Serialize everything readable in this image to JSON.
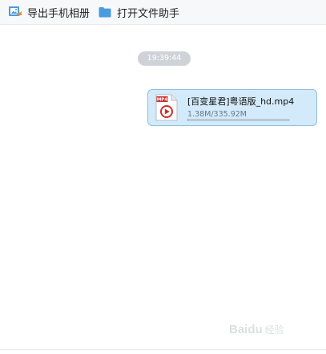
{
  "toolbar": {
    "export_label": "导出手机相册",
    "open_folder_label": "打开文件助手"
  },
  "chat": {
    "timestamp": "19:39:44",
    "file": {
      "name": "[百变星君]粤语版_hd.mp4",
      "size_text": "1.38M/335.92M",
      "progress_fraction": 0.0041,
      "type_badge": "MP4"
    }
  },
  "watermark": {
    "text": "Baidu",
    "sub": "经验"
  },
  "colors": {
    "bubble_bg": "#d3eafb",
    "bubble_border": "#8fbfe0",
    "timestamp_bg": "#cfd3d8",
    "folder_icon": "#4a9be0",
    "video_icon": "#c8302c"
  }
}
